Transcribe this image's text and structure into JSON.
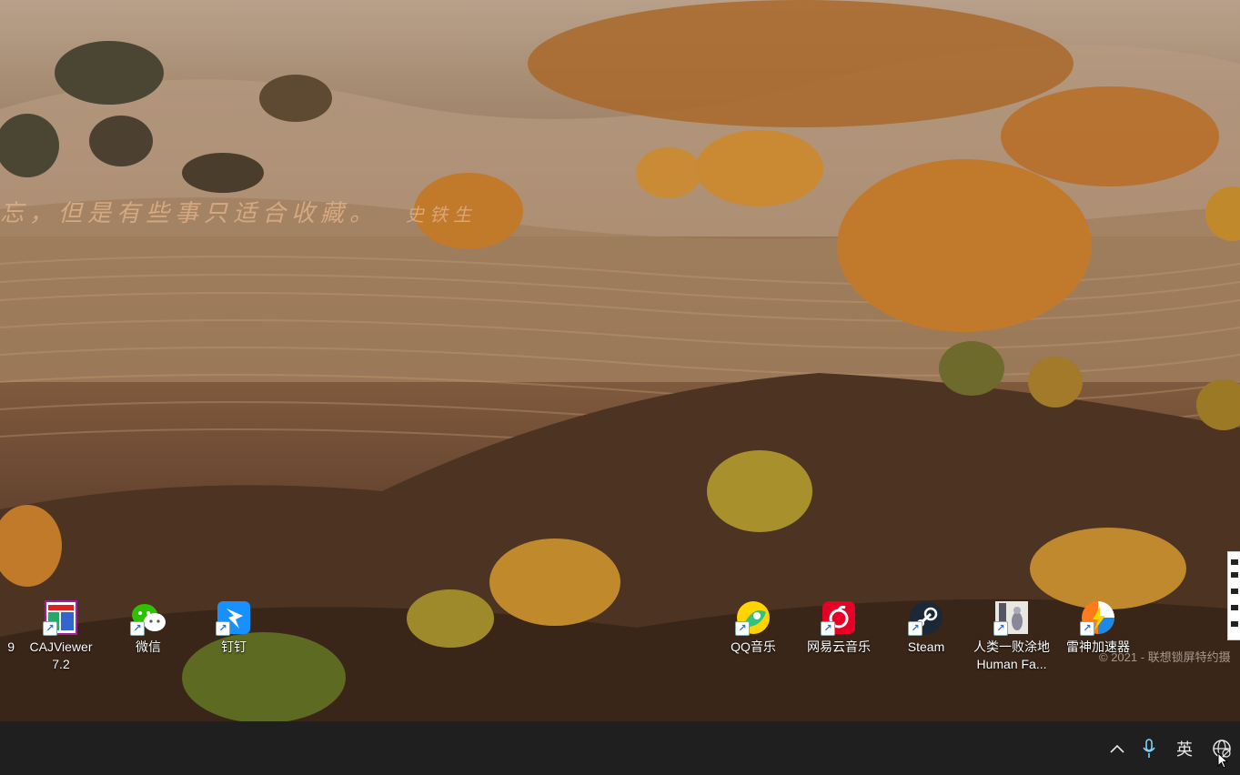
{
  "wallpaper": {
    "calligraphy": "忘，但是有些事只适合收藏。",
    "signature": "史铁生",
    "copyright": "© 2021 - 联想锁屏特约摄"
  },
  "desktop_icons": [
    {
      "label": "9",
      "icon": "partial-app-icon"
    },
    {
      "label": "CAJViewer 7.2",
      "icon": "cajviewer-icon"
    },
    {
      "label": "微信",
      "icon": "wechat-icon"
    },
    {
      "label": "钉钉",
      "icon": "dingtalk-icon"
    },
    {
      "label": "QQ音乐",
      "icon": "qq-music-icon"
    },
    {
      "label": "网易云音乐",
      "icon": "netease-music-icon"
    },
    {
      "label": "Steam",
      "icon": "steam-icon"
    },
    {
      "label": "人类一败涂地 Human Fa...",
      "icon": "human-fall-flat-icon"
    },
    {
      "label": "雷神加速器",
      "icon": "leishen-accelerator-icon"
    }
  ],
  "taskbar": {
    "tray": {
      "chevron": "^",
      "ime": "英",
      "mic_icon": "microphone-icon",
      "network_icon": "network-globe-icon"
    }
  },
  "colors": {
    "taskbar": "#1f1f1f",
    "wechat": "#2dc100",
    "dingtalk": "#1890ff",
    "netease": "#e60026",
    "steam": "#1b2838"
  }
}
